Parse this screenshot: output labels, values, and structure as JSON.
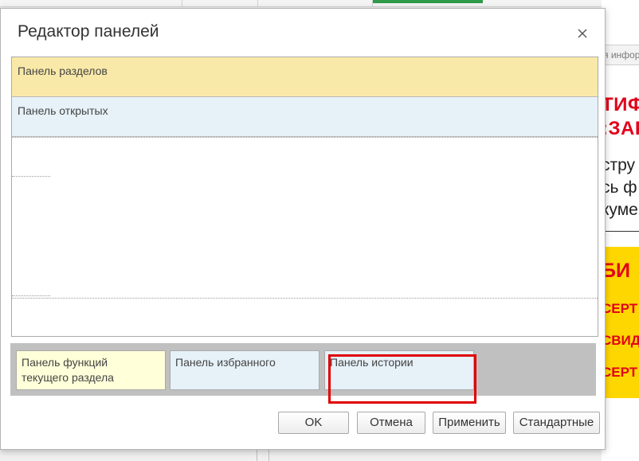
{
  "background": {
    "ghost_text": "я инфор",
    "headline_1": "ТИФ",
    "headline_2": ":ЗАР",
    "body_lines": [
      "стру",
      "сь ф",
      "куме"
    ],
    "banner_title": "БИ",
    "banner_lines": [
      "СЕРТ",
      "СВИД",
      "СЕРТ"
    ]
  },
  "dialog": {
    "title": "Редактор панелей",
    "close_icon": "close-icon",
    "top_panels": {
      "sections": "Панель разделов",
      "open": "Панель открытых"
    },
    "bottom_panels": {
      "functions": [
        "Панель функций",
        "текущего раздела"
      ],
      "favorites": "Панель избранного",
      "history": "Панель истории"
    },
    "buttons": {
      "ok": "OK",
      "cancel": "Отмена",
      "apply": "Применить",
      "standard": "Стандартные"
    },
    "colors": {
      "sections_panel": "#f9e9a8",
      "open_panel": "#e6f1f8",
      "functions_panel": "#ffffd9",
      "highlight_frame": "#e00000"
    }
  }
}
